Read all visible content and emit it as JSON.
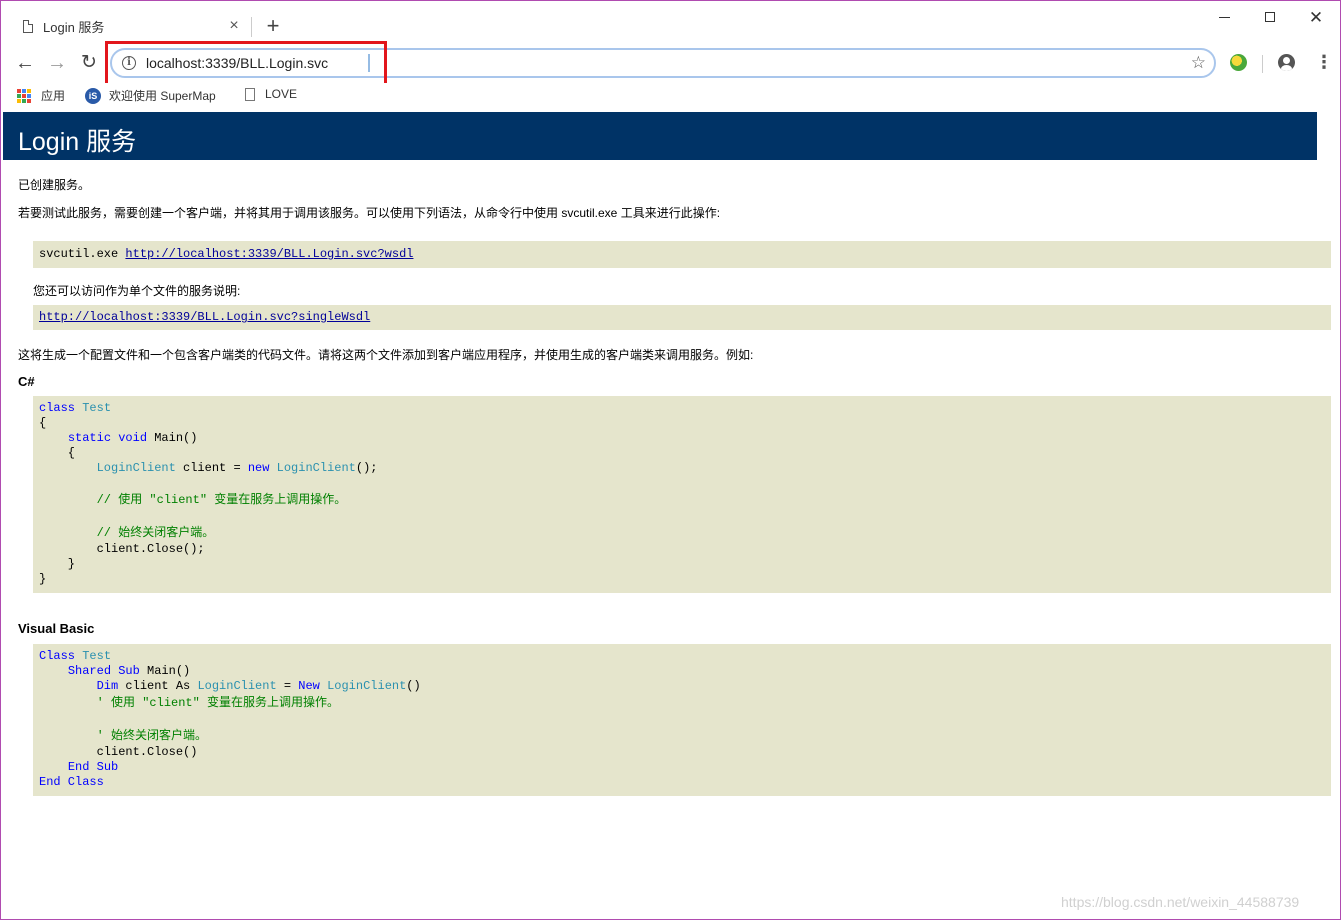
{
  "browser": {
    "tab_title": "Login 服务",
    "tab_close": "×",
    "new_tab": "+",
    "url": "localhost:3339/BLL.Login.svc",
    "info_glyph": "i",
    "bookmarks": [
      {
        "label": "应用"
      },
      {
        "label": "欢迎使用 SuperMap"
      },
      {
        "label": "LOVE"
      }
    ],
    "accent_highlight": "#e2161c"
  },
  "page": {
    "title": "Login 服务",
    "created": "已创建服务。",
    "instruction": "若要测试此服务，需要创建一个客户端，并将其用于调用该服务。可以使用下列语法，从命令行中使用 svcutil.exe 工具来进行此操作:",
    "svcutil_cmd": "svcutil.exe",
    "wsdl_link": "http://localhost:3339/BLL.Login.svc?wsdl",
    "single_file_note": "您还可以访问作为单个文件的服务说明:",
    "single_wsdl_link": "http://localhost:3339/BLL.Login.svc?singleWsdl",
    "generate_note": "这将生成一个配置文件和一个包含客户端类的代码文件。请将这两个文件添加到客户端应用程序，并使用生成的客户端类来调用服务。例如:",
    "csharp_heading": "C#",
    "vb_heading": "Visual Basic",
    "heading_bg": "#003366",
    "code_bg": "#e5e5cc"
  },
  "csharp": {
    "l1_kw": "class",
    "l1_ty": "Test",
    "l2": "{",
    "l3_indent": "    ",
    "l3_kw": "static void",
    "l3_rest": " Main()",
    "l4": "    {",
    "l5_indent": "        ",
    "l5_ty": "LoginClient",
    "l5_mid": " client = ",
    "l5_kw": "new",
    "l5_ty2": "LoginClient",
    "l5_end": "();",
    "l7": "        // 使用 \"client\" 变量在服务上调用操作。",
    "l9": "        // 始终关闭客户端。",
    "l10": "        client.Close();",
    "l11": "    }",
    "l12": "}"
  },
  "vb": {
    "l1_kw": "Class",
    "l1_ty": "Test",
    "l2_indent": "    ",
    "l2_kw": "Shared Sub",
    "l2_rest": " Main()",
    "l3_indent": "        ",
    "l3_kw": "Dim",
    "l3_mid": " client As ",
    "l3_ty": "LoginClient",
    "l3_eq": " = ",
    "l3_kw2": "New",
    "l3_ty2": "LoginClient",
    "l3_end": "()",
    "l4": "        ' 使用 \"client\" 变量在服务上调用操作。",
    "l6": "        ' 始终关闭客户端。",
    "l7": "        client.Close()",
    "l8_indent": "    ",
    "l8_kw": "End Sub",
    "l9_kw": "End Class"
  },
  "watermark": "https://blog.csdn.net/weixin_44588739"
}
